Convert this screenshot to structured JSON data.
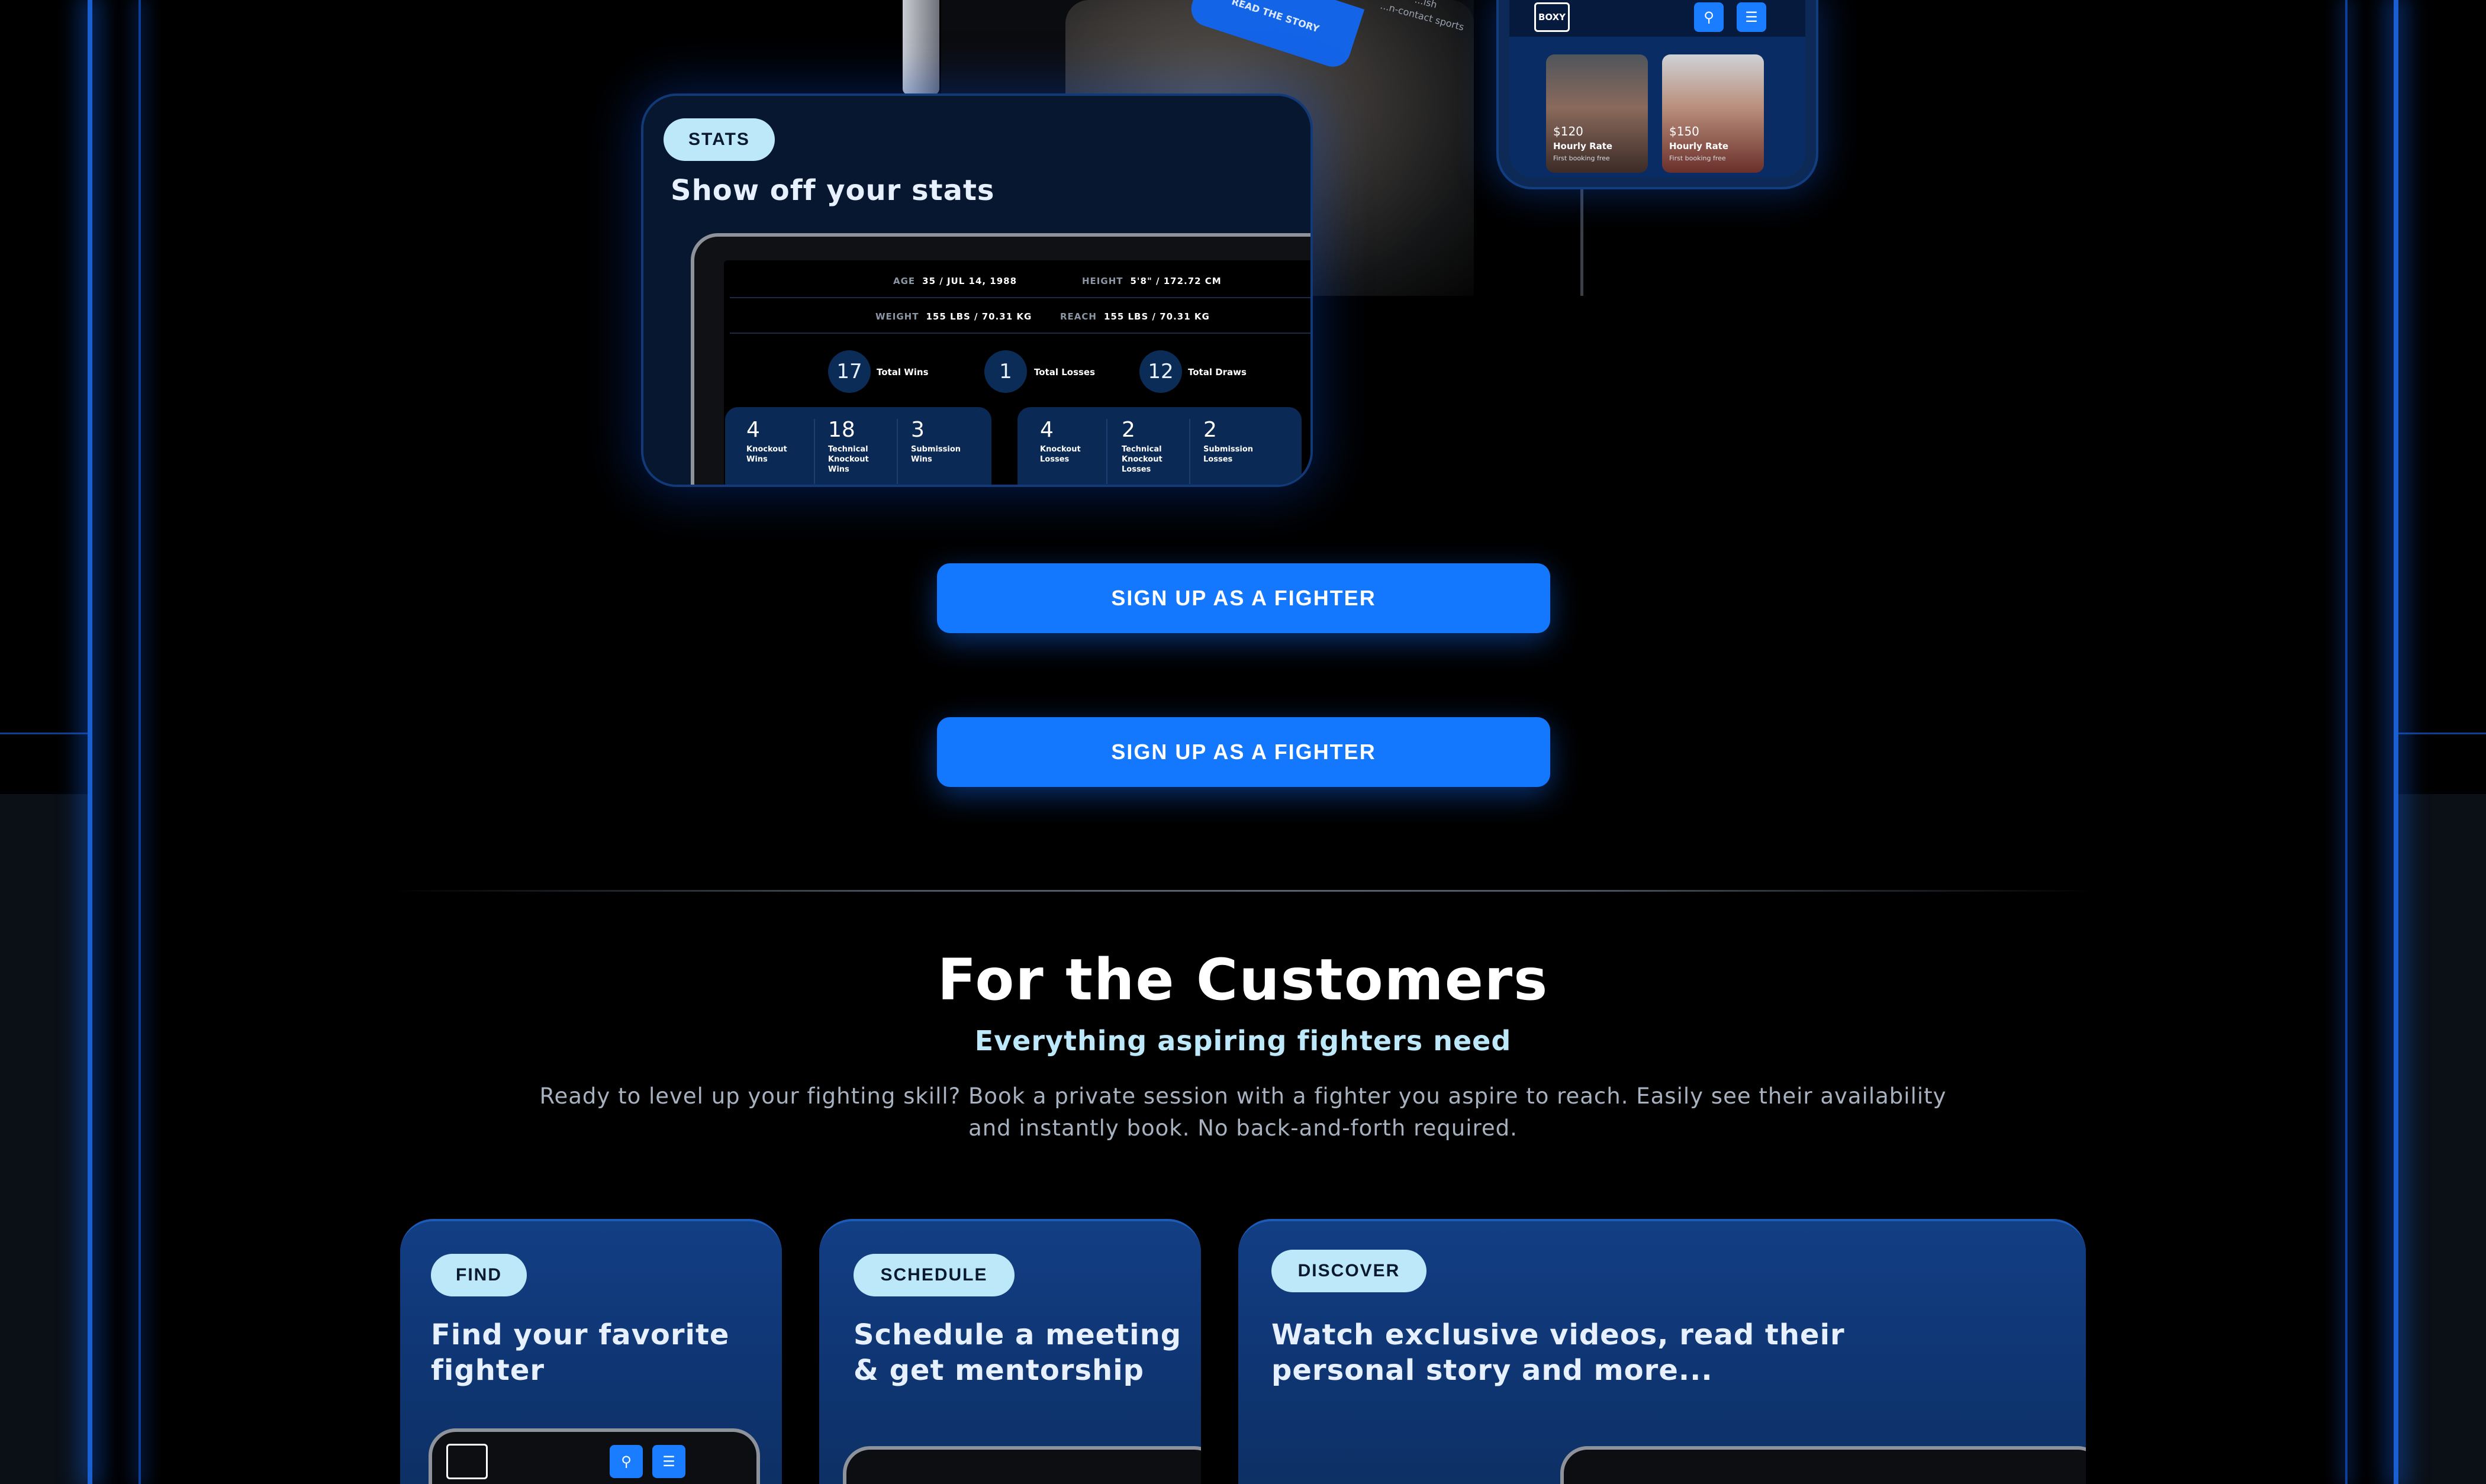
{
  "top_devices": {
    "read_story": "READ THE STORY",
    "side_text_1": "...ish",
    "side_text_2": "...n-contact sports",
    "phone": {
      "logo": "BOXY",
      "search_icon": "search-icon",
      "menu_icon": "menu-icon",
      "cards": [
        {
          "price": "$120",
          "rate_label": "Hourly Rate",
          "sub": "First booking free"
        },
        {
          "price": "$150",
          "rate_label": "Hourly Rate",
          "sub": "First booking free"
        }
      ]
    }
  },
  "stats_card": {
    "badge": "STATS",
    "title": "Show off your stats",
    "info": {
      "age_label": "AGE",
      "age_value": "35 / JUL 14, 1988",
      "height_label": "HEIGHT",
      "height_value": "5'8\" / 172.72 CM",
      "weight_label": "WEIGHT",
      "weight_value": "155 LBS / 70.31 KG",
      "reach_label": "REACH",
      "reach_value": "155 LBS / 70.31 KG"
    },
    "totals": [
      {
        "value": "17",
        "label": "Total Wins"
      },
      {
        "value": "1",
        "label": "Total Losses"
      },
      {
        "value": "12",
        "label": "Total Draws"
      }
    ],
    "wins_breakdown": [
      {
        "value": "4",
        "label": "Knockout Wins"
      },
      {
        "value": "18",
        "label": "Technical Knockout Wins"
      },
      {
        "value": "3",
        "label": "Submission Wins"
      }
    ],
    "losses_breakdown": [
      {
        "value": "4",
        "label": "Knockout Losses"
      },
      {
        "value": "2",
        "label": "Technical Knockout Losses"
      },
      {
        "value": "2",
        "label": "Submission Losses"
      }
    ]
  },
  "cta": {
    "primary": "SIGN UP AS A FIGHTER",
    "secondary": "SIGN UP AS A FIGHTER"
  },
  "customers": {
    "title": "For the Customers",
    "subtitle": "Everything aspiring fighters need",
    "description": "Ready to level up your fighting skill? Book a private session with a fighter you aspire to reach. Easily see their availability and instantly book. No back-and-forth required.",
    "features": [
      {
        "badge": "FIND",
        "title": "Find your favorite fighter"
      },
      {
        "badge": "SCHEDULE",
        "title": "Schedule a meeting & get mentorship"
      },
      {
        "badge": "DISCOVER",
        "title": "Watch exclusive videos, read their personal story and more..."
      }
    ]
  },
  "colors": {
    "accent": "#1478ff",
    "badge_bg": "#bde8f9",
    "card_bg": "#07172f",
    "frame_glow": "#1a5fd0"
  }
}
